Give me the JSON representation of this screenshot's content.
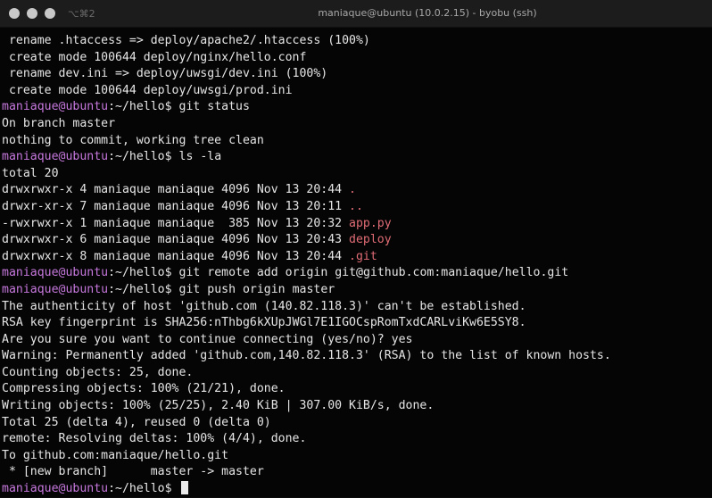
{
  "window": {
    "title": "maniaque@ubuntu (10.0.2.15) - byobu (ssh)",
    "shortcut": "⌥⌘2"
  },
  "prompt": {
    "user": "maniaque@",
    "host": "ubuntu",
    "path": ":~/hello",
    "symbol": "$ "
  },
  "colors": {
    "user": "#c678dd",
    "dir": "#e06c75",
    "text": "#e6e6e6",
    "background": "#050505"
  },
  "lines": [
    " rename .htaccess => deploy/apache2/.htaccess (100%)",
    " create mode 100644 deploy/nginx/hello.conf",
    " rename dev.ini => deploy/uwsgi/dev.ini (100%)",
    " create mode 100644 deploy/uwsgi/prod.ini",
    {
      "cmd": "git status"
    },
    "On branch master",
    "nothing to commit, working tree clean",
    {
      "cmd": "ls -la"
    },
    "total 20",
    {
      "text": "drwxrwxr-x 4 maniaque maniaque 4096 Nov 13 20:44 ",
      "name": "."
    },
    {
      "text": "drwxr-xr-x 7 maniaque maniaque 4096 Nov 13 20:11 ",
      "name": ".."
    },
    {
      "text": "-rwxrwxr-x 1 maniaque maniaque  385 Nov 13 20:32 ",
      "name": "app.py"
    },
    {
      "text": "drwxrwxr-x 6 maniaque maniaque 4096 Nov 13 20:43 ",
      "name": "deploy"
    },
    {
      "text": "drwxrwxr-x 8 maniaque maniaque 4096 Nov 13 20:44 ",
      "name": ".git"
    },
    {
      "cmd": "git remote add origin git@github.com:maniaque/hello.git"
    },
    {
      "cmd": "git push origin master"
    },
    "The authenticity of host 'github.com (140.82.118.3)' can't be established.",
    "RSA key fingerprint is SHA256:nThbg6kXUpJWGl7E1IGOCspRomTxdCARLviKw6E5SY8.",
    "Are you sure you want to continue connecting (yes/no)? yes",
    "Warning: Permanently added 'github.com,140.82.118.3' (RSA) to the list of known hosts.",
    "Counting objects: 25, done.",
    "Compressing objects: 100% (21/21), done.",
    "Writing objects: 100% (25/25), 2.40 KiB | 307.00 KiB/s, done.",
    "Total 25 (delta 4), reused 0 (delta 0)",
    "remote: Resolving deltas: 100% (4/4), done.",
    "To github.com:maniaque/hello.git",
    " * [new branch]      master -> master",
    {
      "cmd": "",
      "cursor": true
    }
  ]
}
